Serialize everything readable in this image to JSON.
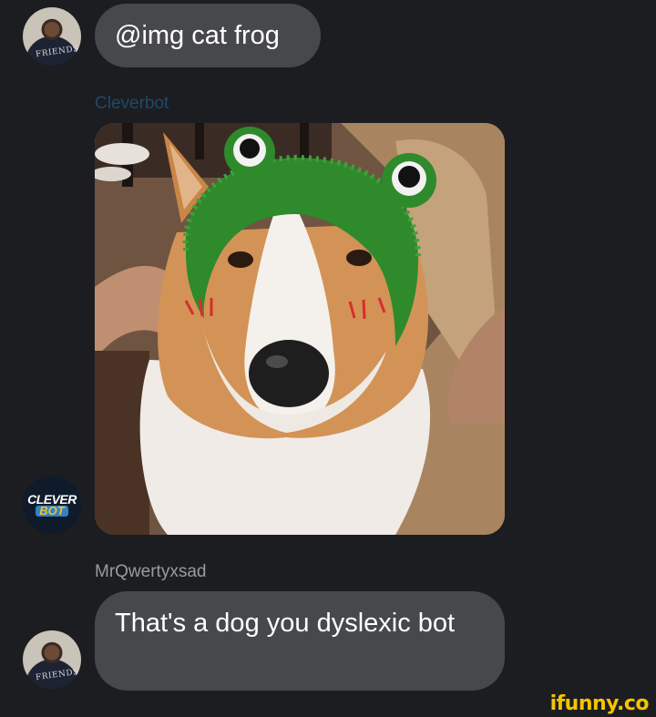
{
  "chat": {
    "messages": [
      {
        "type": "text",
        "text": "@img cat frog"
      },
      {
        "type": "image",
        "sender": "Cleverbot"
      },
      {
        "type": "text",
        "sender": "MrQwertyxsad",
        "text": "That's a dog you dyslexic bot"
      }
    ]
  },
  "avatars": {
    "user_shirt_text": "FRIENDS",
    "bot_logo_top": "CLEVER",
    "bot_logo_bottom": "BOT"
  },
  "watermark": "ifunny.co",
  "colors": {
    "background": "#1c1d21",
    "bubble": "#47484c",
    "bot_name": "#214868",
    "user_name": "#9a9b9f",
    "watermark": "#f5c400"
  }
}
